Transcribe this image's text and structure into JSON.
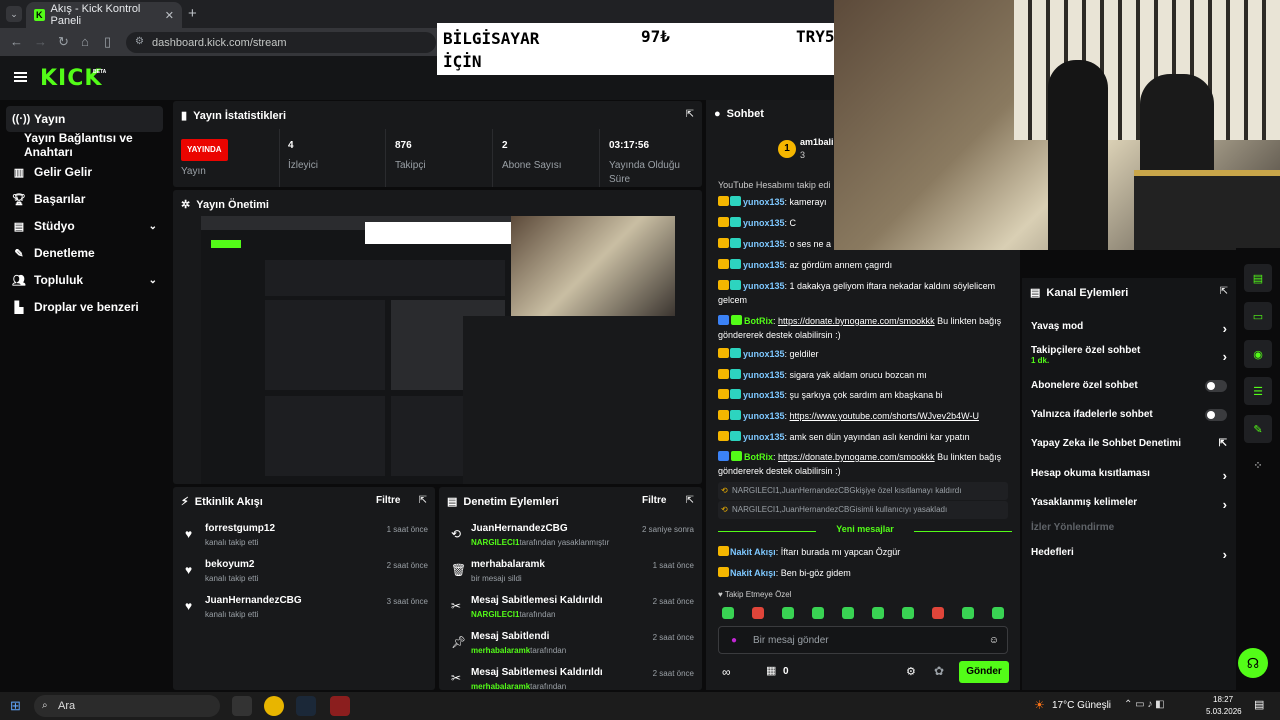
{
  "browser": {
    "tab_title": "Akış - Kick Kontrol Paneli",
    "url": "dashboard.kick.com/stream"
  },
  "overlay": {
    "left_text": "BİLGİSAYAR İÇİN",
    "mid_text": "97₺",
    "right_text": "TRY50000"
  },
  "header": {
    "logo": "KICK",
    "beta": "BETA"
  },
  "sidebar": {
    "items": [
      {
        "label": "Yayın",
        "icon": "broadcast-icon"
      },
      {
        "label": "Yayın Bağlantısı ve Anahtarı",
        "icon": ""
      },
      {
        "label": "Gelir Gelir",
        "icon": "revenue-icon"
      },
      {
        "label": "Başarılar",
        "icon": "trophy-icon"
      },
      {
        "label": "Stüdyo",
        "icon": "studio-icon"
      },
      {
        "label": "Denetleme",
        "icon": "wrench-icon"
      },
      {
        "label": "Topluluk",
        "icon": "people-icon"
      },
      {
        "label": "Droplar ve benzeri",
        "icon": "drops-icon"
      }
    ]
  },
  "stats": {
    "title": "Yayın İstatistikleri",
    "live_badge": "YAYINDA",
    "live_label": "Yayın",
    "viewers": "4",
    "viewers_label": "İzleyici",
    "followers": "876",
    "followers_label": "Takipçi",
    "subs": "2",
    "subs_label": "Abone Sayısı",
    "uptime": "03:17:56",
    "uptime_label": "Yayında Olduğu Süre"
  },
  "management": {
    "title": "Yayın Önetimi"
  },
  "activity": {
    "title": "Etkinlik Akışı",
    "filter": "Filtre",
    "events": [
      {
        "name": "forrestgump12",
        "sub": "kanalı takip etti",
        "time": "1 saat önce"
      },
      {
        "name": "bekoyum2",
        "sub": "kanalı takip etti",
        "time": "2 saat önce"
      },
      {
        "name": "JuanHernandezCBG",
        "sub": "kanalı takip etti",
        "time": "3 saat önce"
      }
    ]
  },
  "moderation": {
    "title": "Denetim Eylemleri",
    "filter": "Filtre",
    "events": [
      {
        "name": "JuanHernandezCBG",
        "actor": "NARGILECI1",
        "rest": "tarafından yasaklanmıştır",
        "time": "2 saniye sonra"
      },
      {
        "name": "merhabalaramk",
        "actor": "",
        "rest": "bir mesajı sildi",
        "time": "1 saat önce"
      },
      {
        "name": "Mesaj Sabitlemesi Kaldırıldı",
        "actor": "NARGILECI1",
        "rest": "tarafından",
        "time": "2 saat önce"
      },
      {
        "name": "Mesaj Sabitlendi",
        "actor": "merhabalaramk",
        "rest": "tarafından",
        "time": "2 saat önce"
      },
      {
        "name": "Mesaj Sabitlemesi Kaldırıldı",
        "actor": "merhabalaramk",
        "rest": "tarafından",
        "time": "2 saat önce"
      }
    ]
  },
  "chat": {
    "title": "Sohbet",
    "top_user": "am1bali",
    "top_count": "3",
    "top_rank": "1",
    "partial_line": "YouTube Hesabımı takip edi",
    "messages": [
      {
        "user": "yunox135",
        "text": ": kamerayı"
      },
      {
        "user": "yunox135",
        "text": ": C"
      },
      {
        "user": "yunox135",
        "text": ": o ses ne a"
      },
      {
        "user": "yunox135",
        "text": ": az gördüm annem çagırdı"
      },
      {
        "user": "yunox135",
        "text": ": 1 dakakya geliyom iftara nekadar kaldını söylelicem gelcem"
      },
      {
        "user": "BotRix",
        "link": "https://donate.bynogame.com/smookkk",
        "text": " Bu linkten bağış göndererek destek olabilirsin :)"
      },
      {
        "user": "yunox135",
        "text": ": geldiler"
      },
      {
        "user": "yunox135",
        "text": ": sigara yak aldam orucu bozcan mı"
      },
      {
        "user": "yunox135",
        "text": ": şu şarkıya çok sardım am kbaşkana bi"
      },
      {
        "user": "yunox135",
        "link": "https://www.youtube.com/shorts/WJvev2b4W-U",
        "text": ""
      },
      {
        "user": "yunox135",
        "text": ": amk sen dün yayından aslı kendini kar ypatın"
      },
      {
        "user": "BotRix",
        "link": "https://donate.bynogame.com/smookkk",
        "text": " Bu linkten bağış göndererek destek olabilirsin :)"
      }
    ],
    "system1": "NARGILECI1,JuanHernandezCBGkişiye özel kısıtlamayı kaldırdı",
    "system2": "NARGILECI1,JuanHernandezCBGisimli kullanıcıyı yasakladı",
    "new_messages": "Yeni mesajlar",
    "new": [
      {
        "user": "Nakit Akışı",
        "text": ": İftarı burada mı yapcan Özgür"
      },
      {
        "user": "Nakit Akışı",
        "text": ": Ben bi-göz gidem"
      }
    ],
    "follow_only": "Takip Etmeye Özel",
    "input_placeholder": "Bir mesaj gönder",
    "points": "0",
    "send": "Gönder"
  },
  "channel_actions": {
    "title": "Kanal Eylemleri",
    "items": [
      {
        "label": "Yavaş mod",
        "kind": "chevron"
      },
      {
        "label": "Takipçilere özel sohbet",
        "sub": "1 dk.",
        "kind": "chevron"
      },
      {
        "label": "Abonelere özel sohbet",
        "kind": "toggle",
        "on": false
      },
      {
        "label": "Yalnızca ifadelerle sohbet",
        "kind": "toggle",
        "on": false
      },
      {
        "label": "Yapay Zeka ile Sohbet Denetimi",
        "kind": "external"
      },
      {
        "label": "Hesap okuma kısıtlaması",
        "kind": "chevron"
      },
      {
        "label": "Yasaklanmış kelimeler",
        "kind": "chevron"
      },
      {
        "label": "İzler Yönlendirme",
        "kind": "disabled"
      },
      {
        "label": "Hedefleri",
        "kind": "chevron"
      }
    ]
  },
  "taskbar": {
    "search": "Ara",
    "weather": "17°C Güneşli",
    "time": "18:27",
    "date": "5.03.2026"
  },
  "colors": {
    "accent": "#53fc18",
    "live": "#eb0400",
    "panel": "#18191b"
  }
}
